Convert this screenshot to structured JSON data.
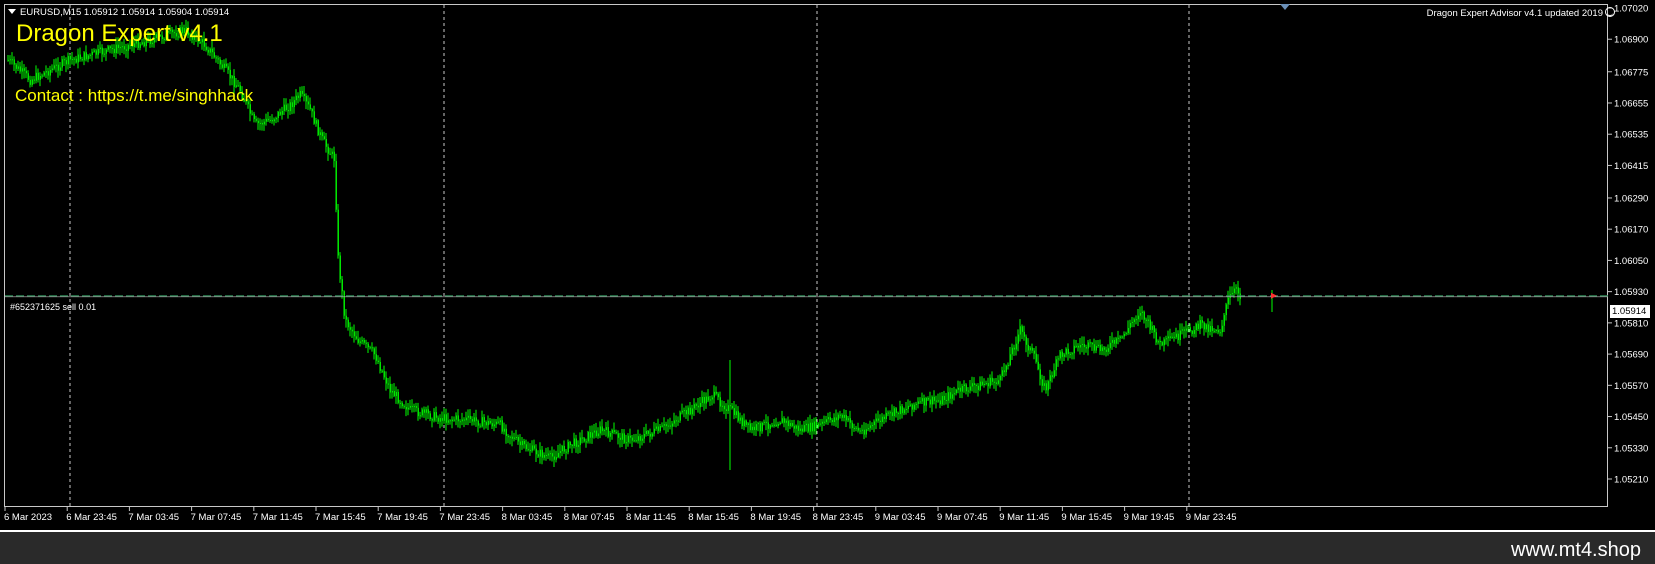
{
  "chart": {
    "symbol_info": "EURUSD,M15  1.05912 1.05914 1.05904 1.05914",
    "ea_title": "Dragon Expert v4.1",
    "ea_contact": "Contact : https://t.me/singhhack",
    "ea_status": "Dragon Expert Advisor v4.1 updated 2019",
    "order_label": "#652371625 sell 0.01",
    "current_price": "1.05914",
    "price_axis": [
      "1.07020",
      "1.06900",
      "1.06775",
      "1.06655",
      "1.06535",
      "1.06415",
      "1.06290",
      "1.06170",
      "1.06050",
      "1.05930",
      "1.05810",
      "1.05690",
      "1.05570",
      "1.05450",
      "1.05330",
      "1.05210"
    ],
    "time_axis": [
      "6 Mar 2023",
      "6 Mar 23:45",
      "7 Mar 03:45",
      "7 Mar 07:45",
      "7 Mar 11:45",
      "7 Mar 15:45",
      "7 Mar 19:45",
      "7 Mar 23:45",
      "8 Mar 03:45",
      "8 Mar 07:45",
      "8 Mar 11:45",
      "8 Mar 15:45",
      "8 Mar 19:45",
      "8 Mar 23:45",
      "9 Mar 03:45",
      "9 Mar 07:45",
      "9 Mar 11:45",
      "9 Mar 15:45",
      "9 Mar 19:45",
      "9 Mar 23:45"
    ],
    "colors": {
      "candle": "#00ff00",
      "grid": "#c8c8c8",
      "order_line": "#2e8b57",
      "text_ea": "#ffff00"
    }
  },
  "footer": {
    "watermark": "www.mt4.shop"
  }
}
